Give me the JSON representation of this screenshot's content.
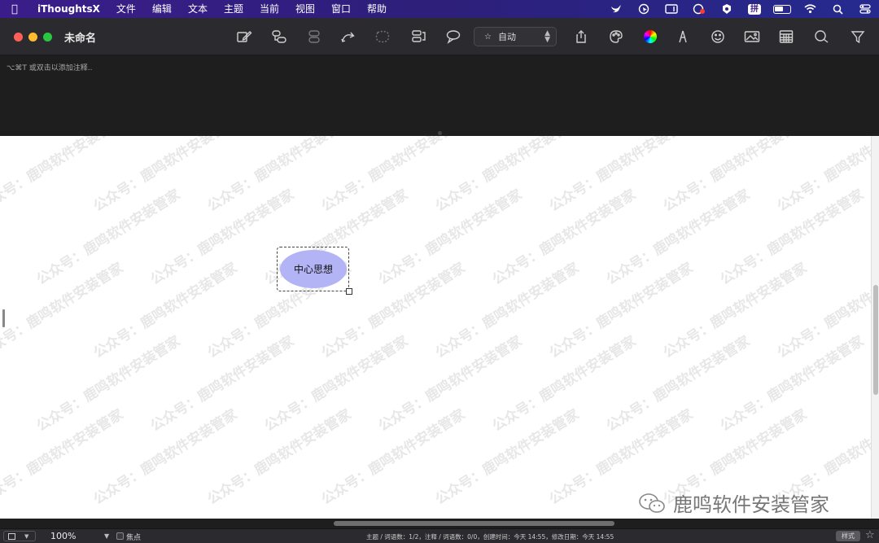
{
  "menubar": {
    "app_name": "iThoughtsX",
    "items": [
      "文件",
      "编辑",
      "文本",
      "主题",
      "当前",
      "视图",
      "窗口",
      "帮助"
    ],
    "input_method": "拼"
  },
  "window": {
    "title": "未命名",
    "style_select": {
      "icon": "☆",
      "value": "自动"
    }
  },
  "notes": {
    "placeholder": "⌥⌘T 或双击以添加注释.."
  },
  "canvas": {
    "central_topic": "中心思想",
    "node_color": "#b3b4f5",
    "watermark_text": "公众号：鹿鸣软件安装管家",
    "brand_text": "鹿鸣软件安装管家"
  },
  "statusbar": {
    "zoom": "100%",
    "focus_label": "焦点",
    "info": "主题 / 词语数：1/2，注释 / 词语数：0/0，创建时间：今天 14:55，修改日期：今天 14:55",
    "style_button": "样式"
  }
}
